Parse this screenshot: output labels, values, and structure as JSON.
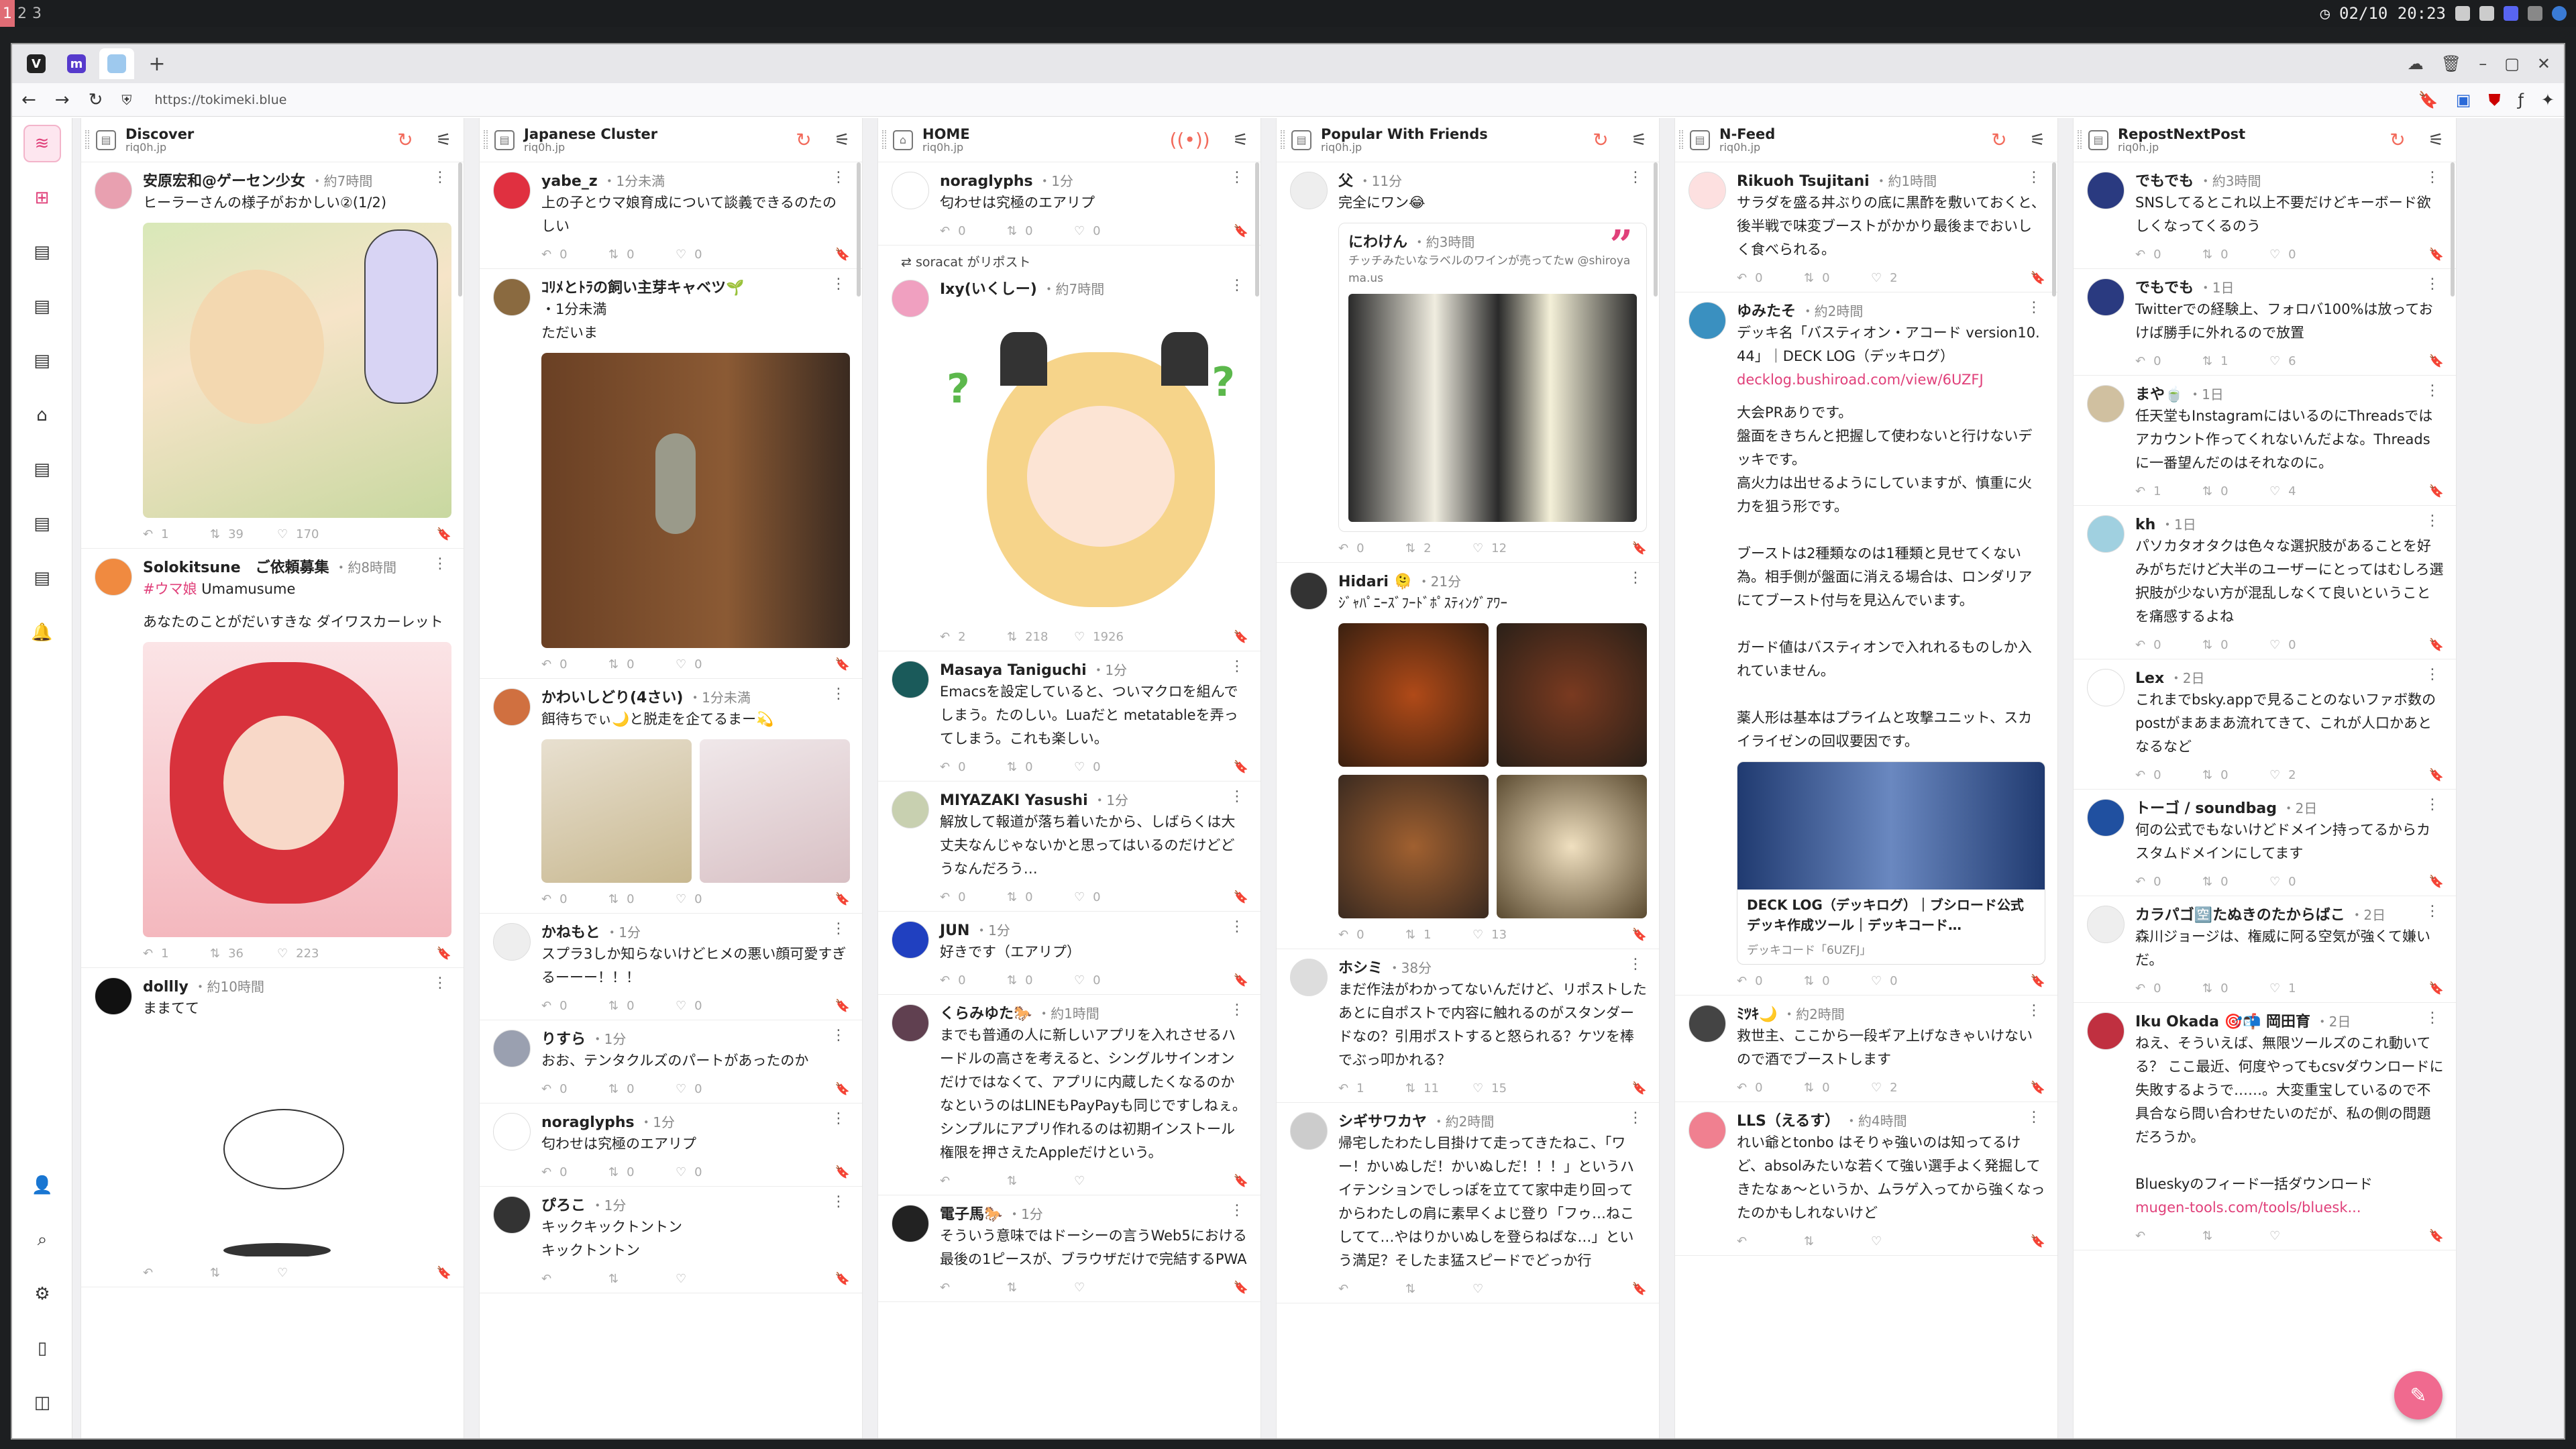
{
  "topbar": {
    "workspaces": [
      "1",
      "2",
      "3"
    ],
    "clock": "02/10 20:23"
  },
  "browser": {
    "url": "https://tokimeki.blue"
  },
  "columns": [
    {
      "title": "Discover",
      "handle": "riq0h.jp",
      "posts": [
        {
          "name": "安原宏和@ゲーセン少女",
          "time": "・約7時間",
          "text": "ヒーラーさんの様子がおかしい②(1/2)",
          "rp": "1",
          "rt": "39",
          "like": "170",
          "media": "manga",
          "avatar": "#e8a0b0"
        },
        {
          "name": "Solokitsune　ご依頼募集",
          "time": "・約8時間",
          "link": "#ウマ娘",
          "text2": " Umamusume",
          "text": "あなたのことがだいすきな ダイワスカーレット",
          "rp": "1",
          "rt": "36",
          "like": "223",
          "media": "redhair",
          "avatar": "#f08a40"
        },
        {
          "name": "dollly",
          "time": "・約10時間",
          "text": "ままてて",
          "rp": "",
          "rt": "",
          "like": "",
          "media": "bird",
          "avatar": "#111"
        }
      ]
    },
    {
      "title": "Japanese Cluster",
      "handle": "riq0h.jp",
      "posts": [
        {
          "name": "yabe_z",
          "time": "・1分未満",
          "text": "上の子とウマ娘育成について談義できるのたのしい",
          "rp": "0",
          "rt": "0",
          "like": "0",
          "avatar": "#e03040"
        },
        {
          "name": "ｺﾘﾒとﾄﾗの飼い主芽キャベツ🌱",
          "time": "",
          "text": "・1分未満\nただいま",
          "rp": "0",
          "rt": "0",
          "like": "0",
          "media": "cat",
          "avatar": "#8a6a40"
        },
        {
          "name": "かわいしどり(4さい)",
          "time": "・1分未満",
          "text": "餌待ちでぃ🌙と脱走を企てるまー💫",
          "rp": "0",
          "rt": "0",
          "like": "0",
          "media": "two",
          "avatar": "#d07040"
        },
        {
          "name": "かねもと",
          "time": "・1分",
          "text": "スプラ3しか知らないけどヒメの悪い顔可愛すぎるーーー！！！",
          "rp": "0",
          "rt": "0",
          "like": "0",
          "avatar": "#eee"
        },
        {
          "name": "りすら",
          "time": "・1分",
          "text": "おお、テンタクルズのパートがあったのか",
          "rp": "0",
          "rt": "0",
          "like": "0",
          "avatar": "#9aa0b0"
        },
        {
          "name": "noraglyphs",
          "time": "・1分",
          "text": "匂わせは究極のエアリプ",
          "rp": "0",
          "rt": "0",
          "like": "0",
          "avatar": "#fff"
        },
        {
          "name": "ぴろこ",
          "time": "・1分",
          "text": "キックキックトントン\nキックトントン",
          "rp": "",
          "rt": "",
          "like": "",
          "avatar": "#333"
        }
      ]
    },
    {
      "title": "HOME",
      "handle": "riq0h.jp",
      "posts": [
        {
          "name": "noraglyphs",
          "time": "・1分",
          "text": "匂わせは究極のエアリプ",
          "rp": "0",
          "rt": "0",
          "like": "0",
          "avatar": "#fff"
        },
        {
          "repost": "soracat がリポスト",
          "name": "Ixy(いくしー)",
          "time": "・約7時間",
          "text": "",
          "rp": "2",
          "rt": "218",
          "like": "1926",
          "media": "catgirl",
          "avatar": "#f0a0c0"
        },
        {
          "name": "Masaya Taniguchi",
          "time": "・1分",
          "text": "Emacsを設定していると、ついマクロを組んでしまう。たのしい。Luaだと metatableを弄ってしまう。これも楽しい。",
          "rp": "0",
          "rt": "0",
          "like": "0",
          "avatar": "#1a5a5a"
        },
        {
          "name": "MIYAZAKI Yasushi",
          "time": "・1分",
          "text": "解放して報道が落ち着いたから、しばらくは大丈夫なんじゃないかと思ってはいるのだけどどうなんだろう…",
          "rp": "0",
          "rt": "0",
          "like": "0",
          "avatar": "#c8d0b0"
        },
        {
          "name": "JUN",
          "time": "・1分",
          "text": "好きです（エアリプ）",
          "rp": "0",
          "rt": "0",
          "like": "0",
          "avatar": "#2040c0"
        },
        {
          "name": "くらみゆた🐎",
          "time": "・約1時間",
          "text": "までも普通の人に新しいアプリを入れさせるハードルの高さを考えると、シングルサインオンだけではなくて、アプリに内蔵したくなるのかなというのはLINEもPayPayも同じですしねぇ。シンプルにアプリ作れるのは初期インストール権限を押さえたAppleだけという。",
          "rp": "",
          "rt": "",
          "like": "",
          "avatar": "#604050"
        },
        {
          "name": "電子馬🐎",
          "time": "・1分",
          "text": "そういう意味ではドーシーの言うWeb5における最後の1ピースが、ブラウザだけで完結するPWA",
          "rp": "",
          "rt": "",
          "like": "",
          "avatar": "#222"
        }
      ]
    },
    {
      "title": "Popular With Friends",
      "handle": "riq0h.jp",
      "posts": [
        {
          "name": "父",
          "time": "・11分",
          "text": "完全にワン😂",
          "rp": "0",
          "rt": "2",
          "like": "12",
          "avatar": "#eee",
          "quote": {
            "name": "にわけん",
            "time": "・約3時間",
            "text": "チッチみたいなラベルのワインが売ってたw @shiroyama.us"
          }
        },
        {
          "name": "Hidari 🫠",
          "time": "・21分",
          "text": "ｼﾞｬﾊﾟﾆｰｽﾞﾌｰﾄﾞﾎﾟｽﾃｨﾝｸﾞｱﾜｰ",
          "rp": "0",
          "rt": "1",
          "like": "13",
          "media": "food",
          "avatar": "#333"
        },
        {
          "name": "ホシミ",
          "time": "・38分",
          "text": "まだ作法がわかってないんだけど、リポストしたあとに自ポストで内容に触れるのがスタンダードなの？引用ポストすると怒られる？ケツを棒でぶっ叩かれる？",
          "rp": "1",
          "rt": "11",
          "like": "15",
          "avatar": "#ddd"
        },
        {
          "name": "シギサワカヤ",
          "time": "・約2時間",
          "text": "帰宅したわたし目掛けて走ってきたねこ、「ワー！かいぬしだ！かいぬしだ！！！」というハイテンションでしっぽを立てて家中走り回ってからわたしの肩に素早くよじ登り「フゥ…ねこしてて…やはりかいぬしを登らねばな…」という満足？そしたま猛スピードでどっか行",
          "rp": "",
          "rt": "",
          "like": "",
          "avatar": "#ccc"
        }
      ]
    },
    {
      "title": "N-Feed",
      "handle": "riq0h.jp",
      "posts": [
        {
          "name": "Rikuoh Tsujitani",
          "time": "・約1時間",
          "text": "サラダを盛る丼ぶりの底に黒酢を敷いておくと、後半戦で味変ブーストがかかり最後までおいしく食べられる。",
          "rp": "0",
          "rt": "0",
          "like": "2",
          "avatar": "#fde0e0"
        },
        {
          "name": "ゆみたそ",
          "time": "・約2時間",
          "text": "デッキ名「バスティオン・アコード version10.44」｜DECK LOG（デッキログ）",
          "link": "decklog.bushiroad.com/view/6UZFJ",
          "text3": "大会PRありです。\n盤面をきちんと把握して使わないと行けないデッキです。\n高火力は出せるようにしていますが、慎重に火力を狙う形です。\n\nブーストは2種類なのは1種類と見せてくない為。相手側が盤面に消える場合は、ロンダリアにてブースト付与を見込んでいます。\n\nガード値はバスティオンで入れれるものしか入れていません。\n\n薬人形は基本はプライムと攻撃ユニット、スカイライゼンの回収要因です。",
          "rp": "0",
          "rt": "0",
          "like": "0",
          "avatar": "#3a90c0",
          "card": {
            "title": "DECK LOG（デッキログ）｜ブシロード公式デッキ作成ツール｜デッキコード…",
            "sub": "デッキコード「6UZFJ」"
          }
        },
        {
          "name": "ﾐﾂｷ🌙",
          "time": "・約2時間",
          "text": "救世主、ここから一段ギア上げなきゃいけないので酒でブーストします",
          "rp": "0",
          "rt": "0",
          "like": "2",
          "avatar": "#444"
        },
        {
          "name": "LLS（えるす）",
          "time": "・約4時間",
          "text": "れい爺とtonbo はそりゃ強いのは知ってるけど、absolみたいな若くて強い選手よく発掘してきたなぁ〜というか、ムラゲ入ってから強くなったのかもしれないけど",
          "rp": "",
          "rt": "",
          "like": "",
          "avatar": "#f08090"
        }
      ]
    },
    {
      "title": "RepostNextPost",
      "handle": "riq0h.jp",
      "posts": [
        {
          "name": "でもでも",
          "time": "・約3時間",
          "text": "SNSしてるとこれ以上不要だけどキーボード欲しくなってくるのう",
          "rp": "0",
          "rt": "0",
          "like": "0",
          "avatar": "#2a3a80"
        },
        {
          "name": "でもでも",
          "time": "・1日",
          "text": "Twitterでの経験上、フォロバ100%は放っておけば勝手に外れるので放置",
          "rp": "0",
          "rt": "1",
          "like": "6",
          "avatar": "#2a3a80"
        },
        {
          "name": "まや🍵",
          "time": "・1日",
          "text": "任天堂もInstagramにはいるのにThreadsではアカウント作ってくれないんだよな。Threadsに一番望んだのはそれなのに。",
          "rp": "1",
          "rt": "0",
          "like": "4",
          "avatar": "#d0c0a0"
        },
        {
          "name": "kh",
          "time": "・1日",
          "text": "パソカタオタクは色々な選択肢があることを好みがちだけど大半のユーザーにとってはむしろ選択肢が少ない方が混乱しなくて良いということを痛感するよね",
          "rp": "0",
          "rt": "0",
          "like": "0",
          "avatar": "#a0d0e0"
        },
        {
          "name": "Lex",
          "time": "・2日",
          "text": "これまでbsky.appで見ることのないファボ数のpostがまあまあ流れてきて、これが人口かあとなるなど",
          "rp": "0",
          "rt": "0",
          "like": "2",
          "avatar": "#fff"
        },
        {
          "name": "トーゴ / soundbag",
          "time": "・2日",
          "text": "何の公式でもないけどドメイン持ってるからカスタムドメインにしてます",
          "rp": "0",
          "rt": "0",
          "like": "0",
          "avatar": "#2050a0"
        },
        {
          "name": "カラパゴ🈳たぬきのたからばこ",
          "time": "・2日",
          "text": "森川ジョージは、権威に阿る空気が強くて嫌いだ。",
          "rp": "0",
          "rt": "0",
          "like": "1",
          "avatar": "#eee"
        },
        {
          "name": "Iku Okada 🎯📬 岡田育",
          "time": "・2日",
          "text": "ねえ、そういえば、無限ツールズのこれ動いてる？ ここ最近、何度やってもcsvダウンロードに失敗するようで……。大変重宝しているので不具合なら問い合わせたいのだが、私の側の問題だろうか。\n\nBlueskyのフィード一括ダウンロード",
          "link": "mugen-tools.com/tools/bluesk...",
          "rp": "",
          "rt": "",
          "like": "",
          "avatar": "#c03040"
        }
      ]
    }
  ]
}
